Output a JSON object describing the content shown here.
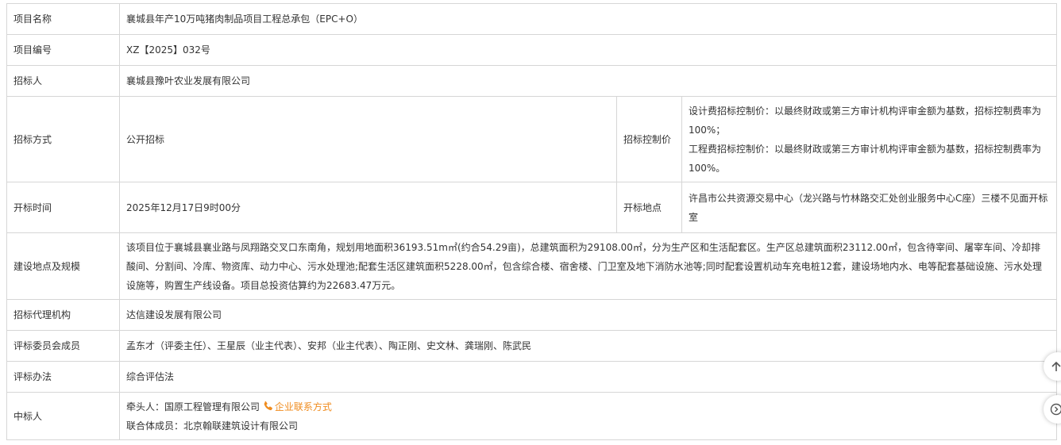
{
  "rows": {
    "project_name": {
      "label": "项目名称",
      "value": "襄城县年产10万吨猪肉制品项目工程总承包（EPC+O）"
    },
    "project_number": {
      "label": "项目编号",
      "value": "XZ【2025】032号"
    },
    "tenderer": {
      "label": "招标人",
      "value": "襄城县豫叶农业发展有限公司"
    },
    "tender_method": {
      "label": "招标方式",
      "value": "公开招标"
    },
    "control_price": {
      "label": "招标控制价",
      "line1": "设计费招标控制价：以最终财政或第三方审计机构评审金额为基数，招标控制费率为100%；",
      "line2": "工程费招标控制价：以最终财政或第三方审计机构评审金额为基数，招标控制费率为100%。"
    },
    "opening_time": {
      "label": "开标时间",
      "value": "2025年12月17日9时00分"
    },
    "opening_place": {
      "label": "开标地点",
      "value": "许昌市公共资源交易中心（龙兴路与竹林路交汇处创业服务中心C座）三楼不见面开标室"
    },
    "site_scale": {
      "label": "建设地点及规模",
      "value": "该项目位于襄城县襄业路与凤翔路交叉口东南角，规划用地面积36193.51m㎡(约合54.29亩)，总建筑面积为29108.00㎡，分为生产区和生活配套区。生产区总建筑面积23112.00㎡，包含待宰间、屠宰车间、冷却排酸间、分割间、冷库、物资库、动力中心、污水处理池;配套生活区建筑面积5228.00㎡，包含综合楼、宿舍楼、门卫室及地下消防水池等;同时配套设置机动车充电桩12套，建设场地内水、电等配套基础设施、污水处理设施等，购置生产线设备。项目总投资估算约为22683.47万元。"
    },
    "agency": {
      "label": "招标代理机构",
      "value": "达信建设发展有限公司"
    },
    "committee": {
      "label": "评标委员会成员",
      "value": "孟东才（评委主任）、王星辰（业主代表）、安邦（业主代表）、陶正刚、史文林、龚瑞刚、陈武民"
    },
    "method": {
      "label": "评标办法",
      "value": "综合评估法"
    },
    "winner": {
      "label": "中标人",
      "lead_prefix": "牵头人：国原工程管理有限公司",
      "contact_link": "企业联系方式",
      "member": "联合体成员：北京翰联建筑设计有限公司"
    }
  },
  "colors": {
    "border": "#d6d6d6",
    "agency": "#e60012",
    "contact": "#f08c1e"
  },
  "icons": [
    "phone-icon",
    "scroll-top-icon",
    "next-icon"
  ]
}
